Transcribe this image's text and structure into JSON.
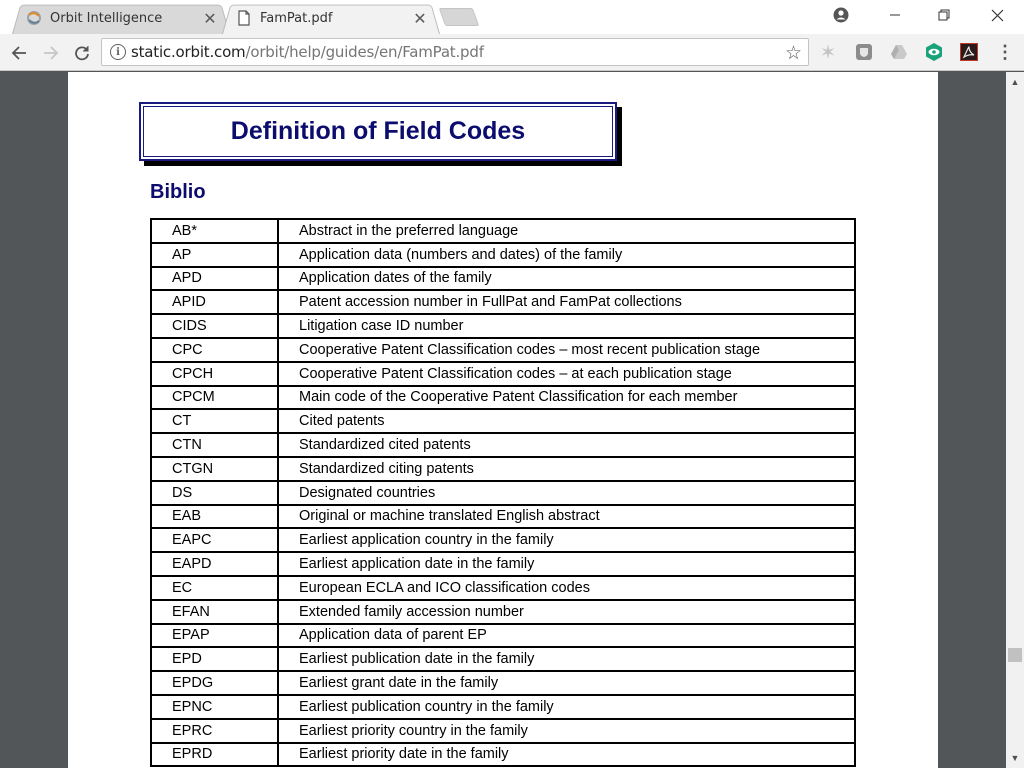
{
  "browser": {
    "tabs": [
      {
        "title": "Orbit Intelligence",
        "icon": "orbit-logo-icon",
        "active": false
      },
      {
        "title": "FamPat.pdf",
        "icon": "document-icon",
        "active": true
      }
    ],
    "address": {
      "host": "static.orbit.com",
      "path": "/orbit/help/guides/en/FamPat.pdf"
    },
    "extensions": [
      "star-extension-icon",
      "shield-extension-icon",
      "drive-extension-icon",
      "eye-extension-icon",
      "acrobat-extension-icon"
    ]
  },
  "document": {
    "title": "Definition of Field Codes",
    "section": "Biblio",
    "accent_color": "#0c0c6e",
    "rows": [
      {
        "code": "AB*",
        "definition": "Abstract in the preferred language"
      },
      {
        "code": "AP",
        "definition": "Application data (numbers and dates) of the family"
      },
      {
        "code": "APD",
        "definition": "Application dates of the family"
      },
      {
        "code": "APID",
        "definition": "Patent accession number in FullPat and FamPat collections"
      },
      {
        "code": "CIDS",
        "definition": "Litigation case ID number"
      },
      {
        "code": "CPC",
        "definition": "Cooperative Patent Classification codes – most recent publication stage"
      },
      {
        "code": "CPCH",
        "definition": "Cooperative Patent Classification codes – at each publication stage"
      },
      {
        "code": "CPCM",
        "definition": "Main code of the Cooperative Patent Classification for each member"
      },
      {
        "code": "CT",
        "definition": "Cited patents"
      },
      {
        "code": "CTN",
        "definition": "Standardized cited patents"
      },
      {
        "code": "CTGN",
        "definition": "Standardized citing patents"
      },
      {
        "code": "DS",
        "definition": "Designated countries"
      },
      {
        "code": "EAB",
        "definition": "Original or machine translated English abstract"
      },
      {
        "code": "EAPC",
        "definition": "Earliest application country in the family"
      },
      {
        "code": "EAPD",
        "definition": "Earliest application date in the family"
      },
      {
        "code": "EC",
        "definition": "European ECLA and ICO classification codes"
      },
      {
        "code": "EFAN",
        "definition": "Extended family accession number"
      },
      {
        "code": "EPAP",
        "definition": "Application data of parent EP"
      },
      {
        "code": "EPD",
        "definition": "Earliest publication date in the family"
      },
      {
        "code": "EPDG",
        "definition": "Earliest grant date in the family"
      },
      {
        "code": "EPNC",
        "definition": "Earliest publication country in the family"
      },
      {
        "code": "EPRC",
        "definition": "Earliest priority country in the family"
      },
      {
        "code": "EPRD",
        "definition": "Earliest priority date in the family"
      }
    ]
  }
}
